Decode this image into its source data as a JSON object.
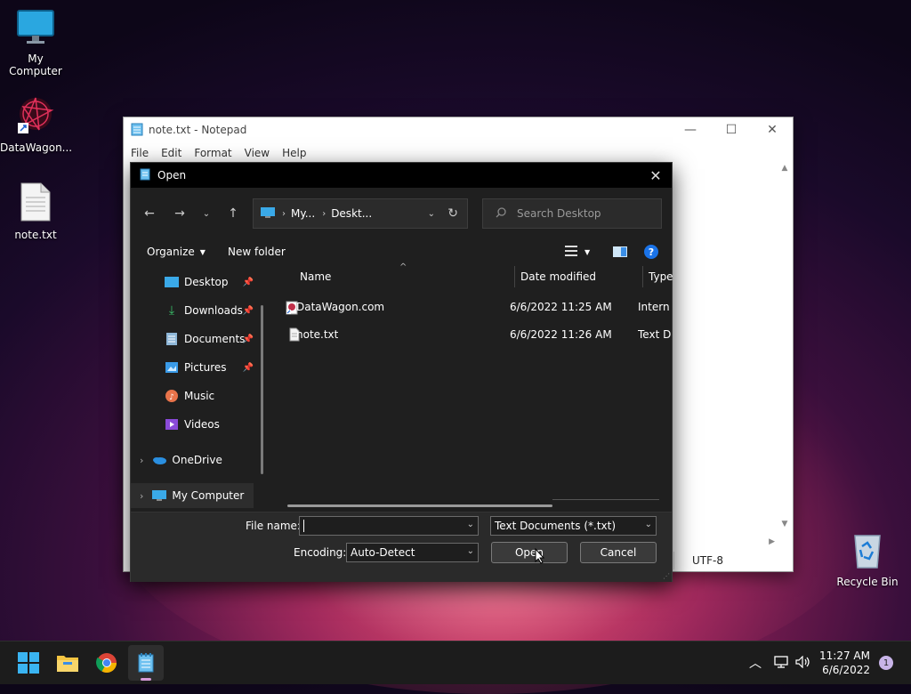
{
  "desktop": {
    "icons": [
      {
        "label": "My Computer"
      },
      {
        "label": "DataWagon..."
      },
      {
        "label": "note.txt"
      },
      {
        "label": "Recycle Bin"
      }
    ]
  },
  "notepad": {
    "title": "note.txt - Notepad",
    "menu": [
      "File",
      "Edit",
      "Format",
      "View",
      "Help"
    ],
    "status_encoding": "UTF-8"
  },
  "dialog": {
    "title": "Open",
    "breadcrumb": [
      "My...",
      "Deskt..."
    ],
    "search_placeholder": "Search Desktop",
    "toolbar": {
      "organize": "Organize",
      "new_folder": "New folder"
    },
    "sidebar": [
      {
        "label": "Desktop",
        "pinned": true
      },
      {
        "label": "Downloads",
        "pinned": true
      },
      {
        "label": "Documents",
        "pinned": true
      },
      {
        "label": "Pictures",
        "pinned": true
      },
      {
        "label": "Music",
        "pinned": false
      },
      {
        "label": "Videos",
        "pinned": false
      },
      {
        "label": "OneDrive",
        "pinned": false
      },
      {
        "label": "My Computer",
        "pinned": false
      }
    ],
    "columns": {
      "name": "Name",
      "date": "Date modified",
      "type": "Type"
    },
    "files": [
      {
        "name": "DataWagon.com",
        "date": "6/6/2022 11:25 AM",
        "type": "Intern"
      },
      {
        "name": "note.txt",
        "date": "6/6/2022 11:26 AM",
        "type": "Text D"
      }
    ],
    "file_name_label": "File name:",
    "file_name_value": "",
    "file_type": "Text Documents (*.txt)",
    "encoding_label": "Encoding:",
    "encoding_value": "Auto-Detect",
    "open_label": "Open",
    "cancel_label": "Cancel"
  },
  "taskbar": {
    "time": "11:27 AM",
    "date": "6/6/2022",
    "notification_count": "1"
  },
  "colors": {
    "accent": "#3a8ee6",
    "dialog_bg": "#1f1f1f"
  }
}
